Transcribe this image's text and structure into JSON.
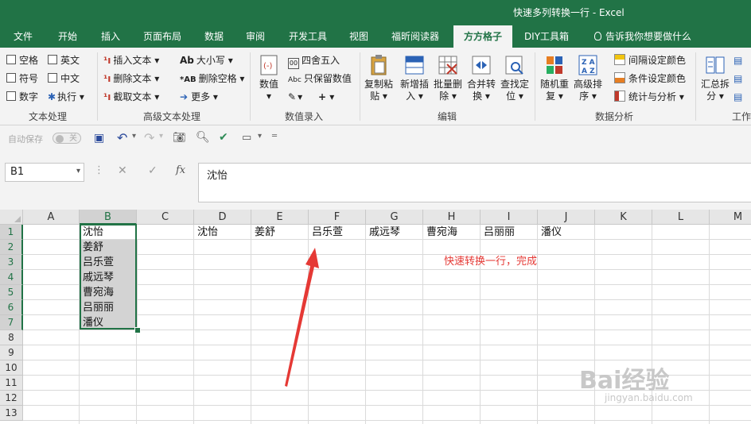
{
  "window": {
    "title": "快速多列转换一行 - Excel"
  },
  "tabs": [
    "文件",
    "开始",
    "插入",
    "页面布局",
    "数据",
    "审阅",
    "开发工具",
    "视图",
    "福昕阅读器",
    "方方格子",
    "DIY工具箱"
  ],
  "active_tab": "方方格子",
  "tell_me": "告诉我你想要做什么",
  "ribbon": {
    "text_proc": {
      "items": [
        "空格",
        "英文",
        "符号",
        "中文",
        "数字",
        "执行"
      ],
      "label": "文本处理"
    },
    "adv_text": {
      "items": [
        "插入文本",
        "删除文本",
        "截取文本",
        "大小写",
        "删除空格",
        "更多"
      ],
      "label": "高级文本处理"
    },
    "value_entry": {
      "items": [
        "数值",
        "四舍五入",
        "只保留数值"
      ],
      "label": "数值录入"
    },
    "edit": {
      "items": [
        "复制粘贴",
        "新增插入",
        "批量删除",
        "合并转换",
        "查找定位"
      ],
      "label": "编辑"
    },
    "data_analysis": {
      "items": [
        "随机重复",
        "高级排序",
        "间隔设定颜色",
        "条件设定颜色",
        "统计与分析"
      ],
      "label": "数据分析"
    },
    "work": {
      "items": [
        "汇总拆分"
      ],
      "label": "工作"
    }
  },
  "qat": {
    "autosave": "自动保存",
    "toggle": "关"
  },
  "formula_bar": {
    "name_box": "B1",
    "content": "沈怡"
  },
  "columns": [
    "A",
    "B",
    "C",
    "D",
    "E",
    "F",
    "G",
    "H",
    "I",
    "J",
    "K",
    "L",
    "M"
  ],
  "rows": [
    "1",
    "2",
    "3",
    "4",
    "5",
    "6",
    "7",
    "8",
    "9",
    "10",
    "11",
    "12",
    "13"
  ],
  "column_b": [
    "沈怡",
    "姜舒",
    "吕乐萱",
    "戚远琴",
    "曹宛海",
    "吕丽丽",
    "潘仪"
  ],
  "row1_values": [
    "沈怡",
    "姜舒",
    "吕乐萱",
    "戚远琴",
    "曹宛海",
    "吕丽丽",
    "潘仪"
  ],
  "annotation": "快速转换一行，完成",
  "watermark": {
    "brand": "Bai经验",
    "url": "jingyan.baidu.com"
  },
  "colors": {
    "excel_green": "#217346",
    "annotation_red": "#e53935"
  }
}
